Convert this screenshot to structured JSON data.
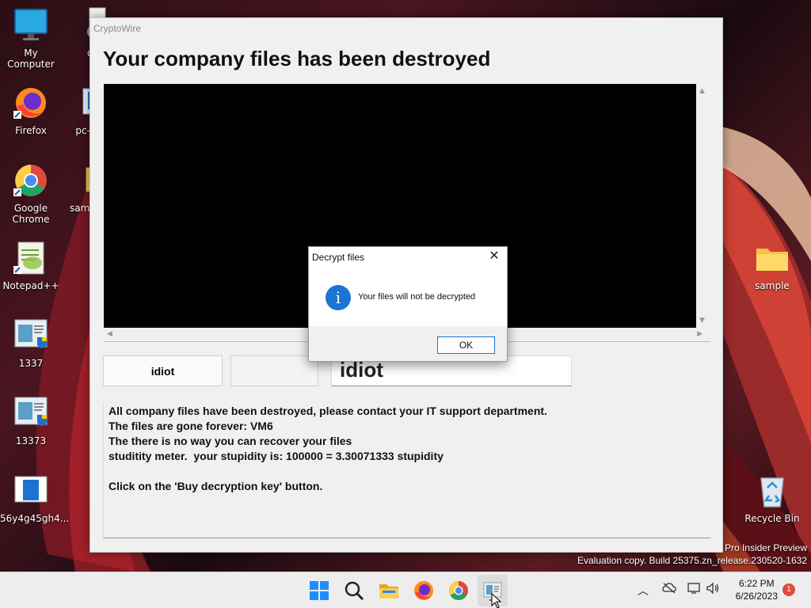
{
  "desktop": {
    "icons_left": [
      {
        "label": "My Computer",
        "icon": "monitor-icon"
      },
      {
        "label": "Firefox",
        "icon": "firefox-icon"
      },
      {
        "label": "Google Chrome",
        "icon": "chrome-icon"
      },
      {
        "label": "Notepad++",
        "icon": "notepadpp-icon"
      },
      {
        "label": "1337",
        "icon": "app-window-icon"
      },
      {
        "label": "13373",
        "icon": "app-window-icon"
      },
      {
        "label": "56y4g45gh4...",
        "icon": "blue-app-icon"
      }
    ],
    "icons_second_column": [
      {
        "label": "desktop",
        "icon": "settings-file-icon"
      },
      {
        "label": "pc-by",
        "icon": "app-window-icon"
      },
      {
        "label": "sampl",
        "icon": "zip-folder-icon"
      }
    ],
    "icons_right": [
      {
        "label": "sample",
        "icon": "folder-icon"
      },
      {
        "label": "Recycle Bin",
        "icon": "recycle-bin-icon"
      }
    ]
  },
  "app": {
    "window_title": "CryptoWire",
    "headline": "Your company files has been destroyed",
    "button_left": "idiot",
    "button_middle": "",
    "text_field": "idiot",
    "message_lines": [
      "All company files have been destroyed, please contact your IT support department.",
      "The files are gone forever: VM6",
      "The there is no way you can recover your files",
      "studitity meter.  your stupidity is: 100000 = 3.30071333 stupidity",
      "",
      "Click on the 'Buy decryption key' button."
    ]
  },
  "dialog": {
    "title": "Decrypt files",
    "message": "Your files will not be decrypted",
    "ok_label": "OK",
    "accent": "#1c73d4"
  },
  "watermark": {
    "line1": "Pro Insider Preview",
    "line2": "Evaluation copy. Build 25375.zn_release.230520-1632"
  },
  "taskbar": {
    "apps": [
      "start-icon",
      "search-icon",
      "file-explorer-icon",
      "firefox-icon",
      "chrome-icon",
      "cryptowire-icon"
    ],
    "time": "6:22 PM",
    "date": "6/26/2023",
    "notification_count": "1"
  }
}
